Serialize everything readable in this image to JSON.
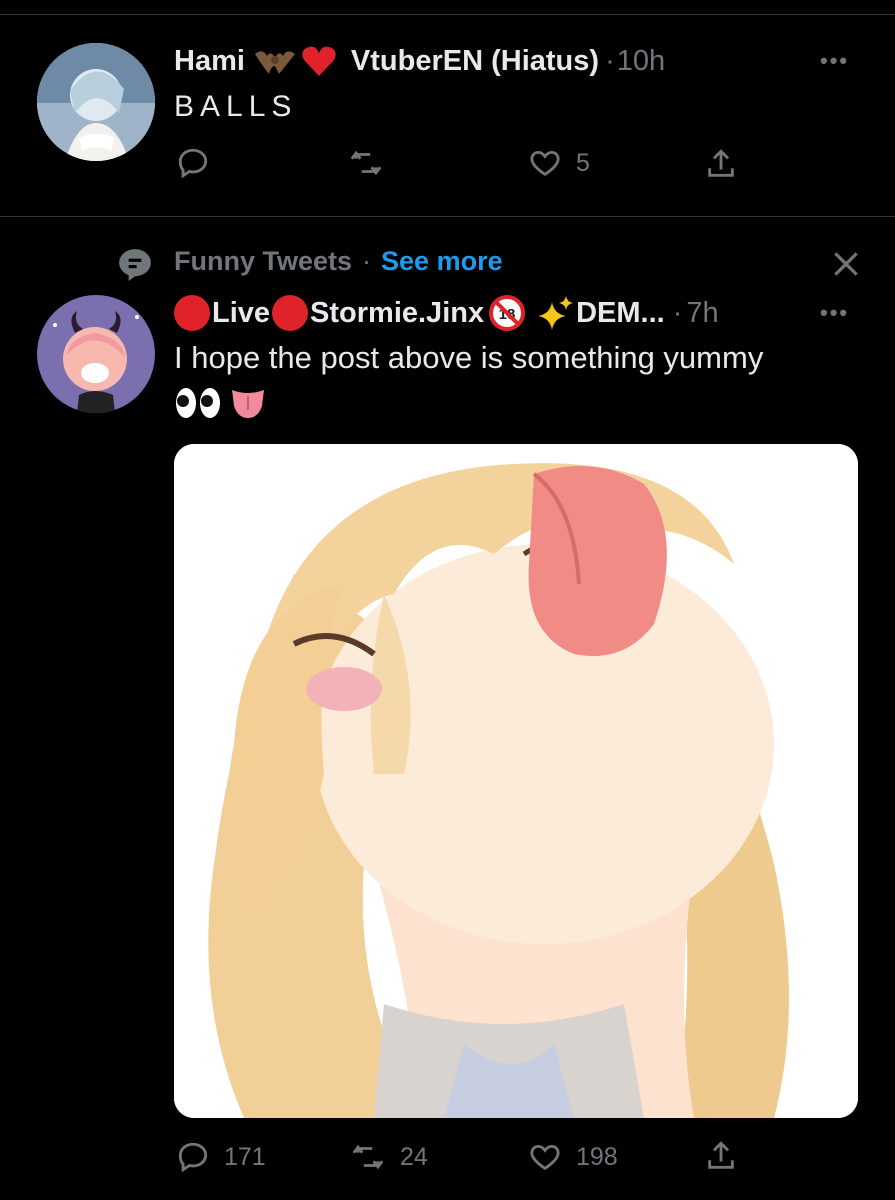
{
  "tweet1": {
    "name": "Hami",
    "name_suffix": "VtuberEN (Hiatus)",
    "time": "10h",
    "text": "BALLS",
    "replies": "",
    "retweets": "",
    "likes": "5"
  },
  "topic_header": {
    "topic": "Funny Tweets",
    "separator": "·",
    "see_more": "See more"
  },
  "tweet2": {
    "live1": "Live",
    "name": "Stormie.Jinx",
    "name_more": "DEM...",
    "time": "7h",
    "text": "I hope the post above is something yummy",
    "replies": "171",
    "retweets": "24",
    "likes": "198"
  },
  "colors": {
    "background": "#000000",
    "text": "#e7e9ea",
    "muted": "#71767b",
    "link": "#1d9bf0",
    "live_red": "#e0232b"
  },
  "icons": [
    "more-icon",
    "reply-icon",
    "retweet-icon",
    "like-icon",
    "share-icon",
    "topic-icon",
    "close-icon",
    "bat-emoji",
    "heart-emoji",
    "no-under-18-emoji",
    "sparkles-emoji",
    "eyes-emoji",
    "tongue-emoji"
  ]
}
